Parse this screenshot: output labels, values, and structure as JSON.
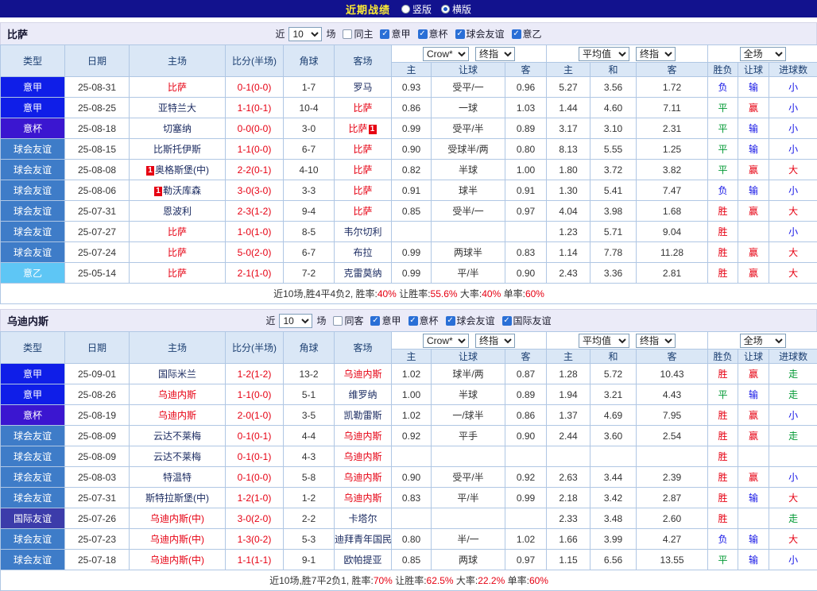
{
  "topbar": {
    "title": "近期战绩",
    "radios": [
      {
        "label": "竖版",
        "selected": false
      },
      {
        "label": "横版",
        "selected": true
      }
    ]
  },
  "table_headers": {
    "main": [
      "类型",
      "日期",
      "主场",
      "比分(半场)",
      "角球",
      "客场"
    ],
    "sub": [
      "主",
      "让球",
      "客",
      "主",
      "和",
      "客",
      "胜负",
      "让球",
      "进球数"
    ]
  },
  "colors": {
    "red": "#e60012",
    "green": "#009933",
    "blue": "#1414e6",
    "league": {
      "意甲": "#0f1ee8",
      "意杯": "#3b16d0",
      "球会友谊": "#3e7cc8",
      "意乙": "#5ec6f5",
      "国际友谊": "#3c3caa"
    },
    "result": {
      "胜": "#e60012",
      "平": "#009933",
      "负": "#1414e6",
      "赢": "#e60012",
      "输": "#1414e6",
      "大": "#e60012",
      "小": "#1414e6",
      "走": "#009933"
    }
  },
  "tables": [
    {
      "team": "比萨",
      "filter": {
        "prefix": "近",
        "count": "10",
        "suffix": "场",
        "same": {
          "label": "同主",
          "checked": false
        },
        "comps": [
          {
            "label": "意甲",
            "checked": true
          },
          {
            "label": "意杯",
            "checked": true
          },
          {
            "label": "球会友谊",
            "checked": true
          },
          {
            "label": "意乙",
            "checked": true
          }
        ]
      },
      "selects": {
        "bookmaker": "Crow*",
        "bookmaker_period": "终指",
        "average": "平均值",
        "average_period": "终指",
        "scope": "全场"
      },
      "rows": [
        {
          "type": "意甲",
          "date": "25-08-31",
          "home": {
            "name": "比萨",
            "red": true
          },
          "score": "0-1(0-0)",
          "corner": "1-7",
          "away": {
            "name": "罗马"
          },
          "odds": [
            "0.93",
            "受平/一",
            "0.96"
          ],
          "avg": [
            "5.27",
            "3.56",
            "1.72"
          ],
          "result": "负",
          "handicap": "输",
          "goals": "小"
        },
        {
          "type": "意甲",
          "date": "25-08-25",
          "home": {
            "name": "亚特兰大"
          },
          "score": "1-1(0-1)",
          "corner": "10-4",
          "away": {
            "name": "比萨",
            "red": true
          },
          "odds": [
            "0.86",
            "一球",
            "1.03"
          ],
          "avg": [
            "1.44",
            "4.60",
            "7.11"
          ],
          "result": "平",
          "handicap": "赢",
          "goals": "小"
        },
        {
          "type": "意杯",
          "date": "25-08-18",
          "home": {
            "name": "切塞纳"
          },
          "score": "0-0(0-0)",
          "corner": "3-0",
          "away": {
            "name": "比萨",
            "red": true,
            "badge": "1",
            "badge_pos": "post"
          },
          "odds": [
            "0.99",
            "受平/半",
            "0.89"
          ],
          "avg": [
            "3.17",
            "3.10",
            "2.31"
          ],
          "result": "平",
          "handicap": "输",
          "goals": "小"
        },
        {
          "type": "球会友谊",
          "date": "25-08-15",
          "home": {
            "name": "比斯托伊斯"
          },
          "score": "1-1(0-0)",
          "corner": "6-7",
          "away": {
            "name": "比萨",
            "red": true
          },
          "odds": [
            "0.90",
            "受球半/两",
            "0.80"
          ],
          "avg": [
            "8.13",
            "5.55",
            "1.25"
          ],
          "result": "平",
          "handicap": "输",
          "goals": "小"
        },
        {
          "type": "球会友谊",
          "date": "25-08-08",
          "home": {
            "name": "奥格斯堡(中)",
            "badge": "1",
            "badge_pos": "pre"
          },
          "score": "2-2(0-1)",
          "corner": "4-10",
          "away": {
            "name": "比萨",
            "red": true
          },
          "odds": [
            "0.82",
            "半球",
            "1.00"
          ],
          "avg": [
            "1.80",
            "3.72",
            "3.82"
          ],
          "result": "平",
          "handicap": "赢",
          "goals": "大"
        },
        {
          "type": "球会友谊",
          "date": "25-08-06",
          "home": {
            "name": "勒沃库森",
            "badge": "1",
            "badge_pos": "pre"
          },
          "score": "3-0(3-0)",
          "corner": "3-3",
          "away": {
            "name": "比萨",
            "red": true
          },
          "odds": [
            "0.91",
            "球半",
            "0.91"
          ],
          "avg": [
            "1.30",
            "5.41",
            "7.47"
          ],
          "result": "负",
          "handicap": "输",
          "goals": "小"
        },
        {
          "type": "球会友谊",
          "date": "25-07-31",
          "home": {
            "name": "恩波利"
          },
          "score": "2-3(1-2)",
          "corner": "9-4",
          "away": {
            "name": "比萨",
            "red": true
          },
          "odds": [
            "0.85",
            "受半/一",
            "0.97"
          ],
          "avg": [
            "4.04",
            "3.98",
            "1.68"
          ],
          "result": "胜",
          "handicap": "赢",
          "goals": "大"
        },
        {
          "type": "球会友谊",
          "date": "25-07-27",
          "home": {
            "name": "比萨",
            "red": true
          },
          "score": "1-0(1-0)",
          "corner": "8-5",
          "away": {
            "name": "韦尔切利"
          },
          "odds": [
            "",
            "",
            ""
          ],
          "avg": [
            "1.23",
            "5.71",
            "9.04"
          ],
          "result": "胜",
          "handicap": "",
          "goals": "小"
        },
        {
          "type": "球会友谊",
          "date": "25-07-24",
          "home": {
            "name": "比萨",
            "red": true
          },
          "score": "5-0(2-0)",
          "corner": "6-7",
          "away": {
            "name": "布拉"
          },
          "odds": [
            "0.99",
            "两球半",
            "0.83"
          ],
          "avg": [
            "1.14",
            "7.78",
            "11.28"
          ],
          "result": "胜",
          "handicap": "赢",
          "goals": "大"
        },
        {
          "type": "意乙",
          "date": "25-05-14",
          "home": {
            "name": "比萨",
            "red": true
          },
          "score": "2-1(1-0)",
          "corner": "7-2",
          "away": {
            "name": "克雷莫纳"
          },
          "odds": [
            "0.99",
            "平/半",
            "0.90"
          ],
          "avg": [
            "2.43",
            "3.36",
            "2.81"
          ],
          "result": "胜",
          "handicap": "赢",
          "goals": "大"
        }
      ],
      "summary": [
        {
          "text": "近10场,胜4平4负2, 胜率:",
          "red": false
        },
        {
          "text": "40%",
          "red": true
        },
        {
          "text": " 让胜率:",
          "red": false
        },
        {
          "text": "55.6%",
          "red": true
        },
        {
          "text": " 大率:",
          "red": false
        },
        {
          "text": "40%",
          "red": true
        },
        {
          "text": " 单率:",
          "red": false
        },
        {
          "text": "60%",
          "red": true
        }
      ]
    },
    {
      "team": "乌迪内斯",
      "filter": {
        "prefix": "近",
        "count": "10",
        "suffix": "场",
        "same": {
          "label": "同客",
          "checked": false
        },
        "comps": [
          {
            "label": "意甲",
            "checked": true
          },
          {
            "label": "意杯",
            "checked": true
          },
          {
            "label": "球会友谊",
            "checked": true
          },
          {
            "label": "国际友谊",
            "checked": true
          }
        ]
      },
      "selects": {
        "bookmaker": "Crow*",
        "bookmaker_period": "终指",
        "average": "平均值",
        "average_period": "终指",
        "scope": "全场"
      },
      "rows": [
        {
          "type": "意甲",
          "date": "25-09-01",
          "home": {
            "name": "国际米兰"
          },
          "score": "1-2(1-2)",
          "corner": "13-2",
          "away": {
            "name": "乌迪内斯",
            "red": true
          },
          "odds": [
            "1.02",
            "球半/两",
            "0.87"
          ],
          "avg": [
            "1.28",
            "5.72",
            "10.43"
          ],
          "result": "胜",
          "handicap": "赢",
          "goals": "走"
        },
        {
          "type": "意甲",
          "date": "25-08-26",
          "home": {
            "name": "乌迪内斯",
            "red": true
          },
          "score": "1-1(0-0)",
          "corner": "5-1",
          "away": {
            "name": "维罗纳"
          },
          "odds": [
            "1.00",
            "半球",
            "0.89"
          ],
          "avg": [
            "1.94",
            "3.21",
            "4.43"
          ],
          "result": "平",
          "handicap": "输",
          "goals": "走"
        },
        {
          "type": "意杯",
          "date": "25-08-19",
          "home": {
            "name": "乌迪内斯",
            "red": true
          },
          "score": "2-0(1-0)",
          "corner": "3-5",
          "away": {
            "name": "凯勒雷斯"
          },
          "odds": [
            "1.02",
            "一/球半",
            "0.86"
          ],
          "avg": [
            "1.37",
            "4.69",
            "7.95"
          ],
          "result": "胜",
          "handicap": "赢",
          "goals": "小"
        },
        {
          "type": "球会友谊",
          "date": "25-08-09",
          "home": {
            "name": "云达不莱梅"
          },
          "score": "0-1(0-1)",
          "corner": "4-4",
          "away": {
            "name": "乌迪内斯",
            "red": true
          },
          "odds": [
            "0.92",
            "平手",
            "0.90"
          ],
          "avg": [
            "2.44",
            "3.60",
            "2.54"
          ],
          "result": "胜",
          "handicap": "赢",
          "goals": "走"
        },
        {
          "type": "球会友谊",
          "date": "25-08-09",
          "home": {
            "name": "云达不莱梅"
          },
          "score": "0-1(0-1)",
          "corner": "4-3",
          "away": {
            "name": "乌迪内斯",
            "red": true
          },
          "odds": [
            "",
            "",
            ""
          ],
          "avg": [
            "",
            "",
            ""
          ],
          "result": "胜",
          "handicap": "",
          "goals": ""
        },
        {
          "type": "球会友谊",
          "date": "25-08-03",
          "home": {
            "name": "特温特"
          },
          "score": "0-1(0-0)",
          "corner": "5-8",
          "away": {
            "name": "乌迪内斯",
            "red": true
          },
          "odds": [
            "0.90",
            "受平/半",
            "0.92"
          ],
          "avg": [
            "2.63",
            "3.44",
            "2.39"
          ],
          "result": "胜",
          "handicap": "赢",
          "goals": "小"
        },
        {
          "type": "球会友谊",
          "date": "25-07-31",
          "home": {
            "name": "斯特拉斯堡(中)"
          },
          "score": "1-2(1-0)",
          "corner": "1-2",
          "away": {
            "name": "乌迪内斯",
            "red": true
          },
          "odds": [
            "0.83",
            "平/半",
            "0.99"
          ],
          "avg": [
            "2.18",
            "3.42",
            "2.87"
          ],
          "result": "胜",
          "handicap": "输",
          "goals": "大"
        },
        {
          "type": "国际友谊",
          "date": "25-07-26",
          "home": {
            "name": "乌迪内斯(中)",
            "red": true
          },
          "score": "3-0(2-0)",
          "corner": "2-2",
          "away": {
            "name": "卡塔尔"
          },
          "odds": [
            "",
            "",
            ""
          ],
          "avg": [
            "2.33",
            "3.48",
            "2.60"
          ],
          "result": "胜",
          "handicap": "",
          "goals": "走"
        },
        {
          "type": "球会友谊",
          "date": "25-07-23",
          "home": {
            "name": "乌迪内斯(中)",
            "red": true
          },
          "score": "1-3(0-2)",
          "corner": "5-3",
          "away": {
            "name": "迪拜青年国民"
          },
          "odds": [
            "0.80",
            "半/一",
            "1.02"
          ],
          "avg": [
            "1.66",
            "3.99",
            "4.27"
          ],
          "result": "负",
          "handicap": "输",
          "goals": "大"
        },
        {
          "type": "球会友谊",
          "date": "25-07-18",
          "home": {
            "name": "乌迪内斯(中)",
            "red": true
          },
          "score": "1-1(1-1)",
          "corner": "9-1",
          "away": {
            "name": "欧帕提亚"
          },
          "odds": [
            "0.85",
            "两球",
            "0.97"
          ],
          "avg": [
            "1.15",
            "6.56",
            "13.55"
          ],
          "result": "平",
          "handicap": "输",
          "goals": "小"
        }
      ],
      "summary": [
        {
          "text": "近10场,胜7平2负1, 胜率:",
          "red": false
        },
        {
          "text": "70%",
          "red": true
        },
        {
          "text": " 让胜率:",
          "red": false
        },
        {
          "text": "62.5%",
          "red": true
        },
        {
          "text": " 大率:",
          "red": false
        },
        {
          "text": "22.2%",
          "red": true
        },
        {
          "text": " 单率:",
          "red": false
        },
        {
          "text": "60%",
          "red": true
        }
      ]
    }
  ]
}
